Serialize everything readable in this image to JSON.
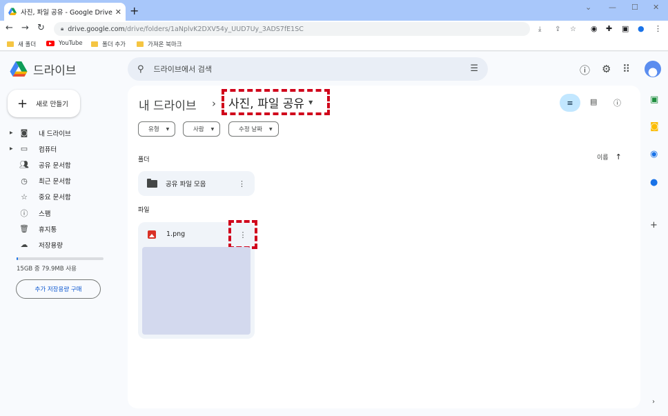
{
  "browser": {
    "tab_title": "사진, 파일 공유 - Google Drive",
    "tab_close": "✕",
    "new_tab": "+",
    "url_host": "drive.google.com",
    "url_path": "/drive/folders/1aNplvK2DXV54y_UUD7Uy_3ADS7fE1SC",
    "bookmarks": [
      "새 폴더",
      "YouTube",
      "폴더 추가",
      "가져온 북마크"
    ]
  },
  "drive": {
    "logo_text": "드라이브",
    "search_placeholder": "드라이브에서 검색",
    "new_button": "새로 만들기",
    "nav": [
      {
        "label": "내 드라이브",
        "icon": "drive-icon"
      },
      {
        "label": "컴퓨터",
        "icon": "computer-icon"
      },
      {
        "label": "공유 문서함",
        "icon": "people-icon"
      },
      {
        "label": "최근 문서함",
        "icon": "clock-icon"
      },
      {
        "label": "중요 문서함",
        "icon": "star-icon"
      },
      {
        "label": "스팸",
        "icon": "spam-icon"
      },
      {
        "label": "휴지통",
        "icon": "trash-icon"
      },
      {
        "label": "저장용량",
        "icon": "cloud-icon"
      }
    ],
    "storage_text": "15GB 중 79.9MB 사용",
    "storage_fraction": 0.005,
    "buy_storage": "추가 저장용량 구매",
    "breadcrumb_root": "내 드라이브",
    "breadcrumb_current": "사진, 파일 공유",
    "chips": [
      "유형",
      "사람",
      "수정 날짜"
    ],
    "folders_label": "폴더",
    "sort_label": "이름",
    "folder_name": "공유 파일 모음",
    "files_label": "파일",
    "file_name": "1.png"
  },
  "colors": {
    "highlight": "#d0021b",
    "accent": "#1a73e8",
    "thumbnail": "#d3d9ee"
  }
}
